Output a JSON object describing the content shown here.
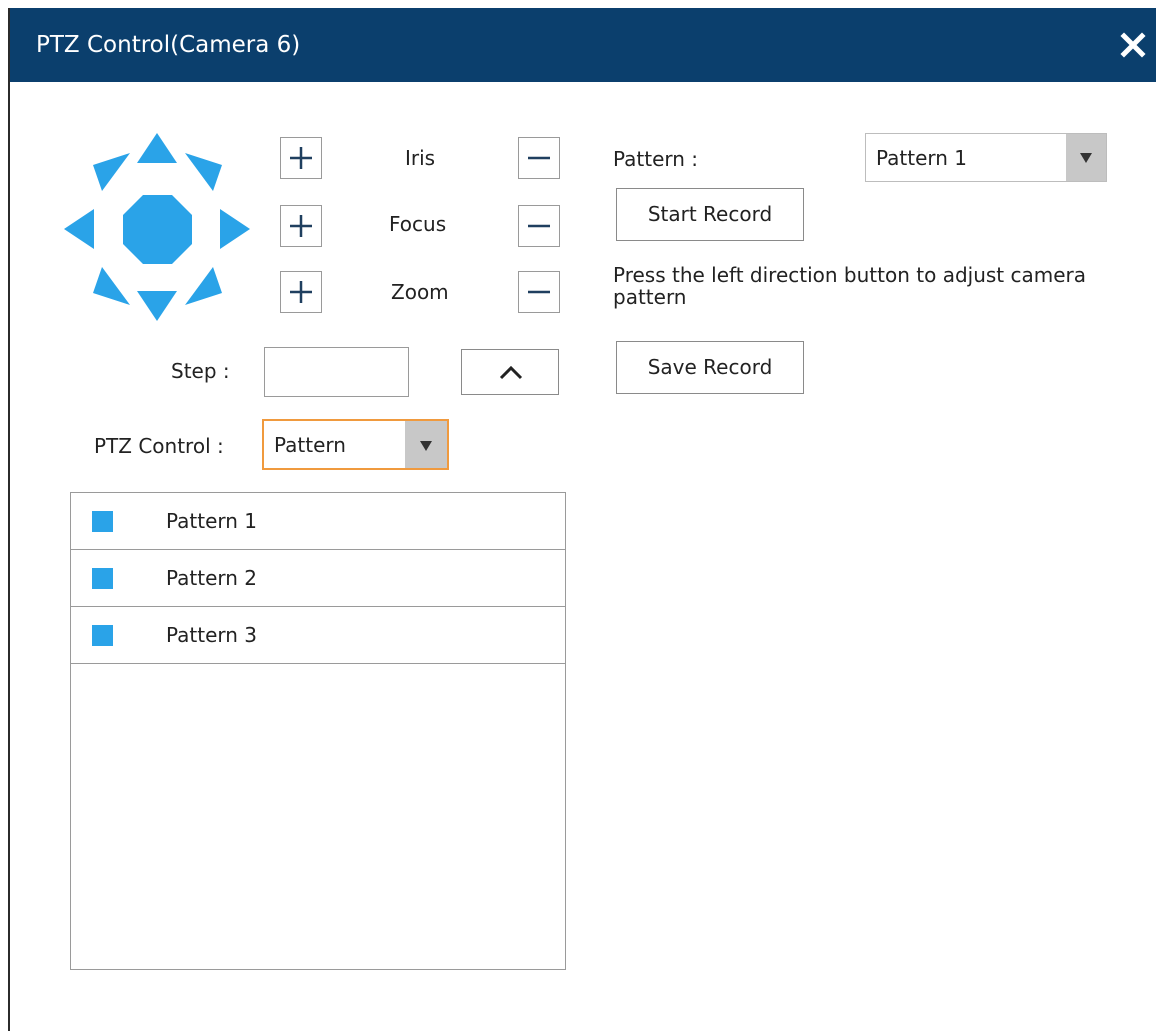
{
  "dialog": {
    "title": "PTZ Control(Camera 6)",
    "close_icon": "close-icon"
  },
  "colors": {
    "titlebar": "#0b3f6d",
    "accent": "#2aa3e8",
    "focus_border": "#f09a3e"
  },
  "lens": {
    "iris_label": "Iris",
    "focus_label": "Focus",
    "zoom_label": "Zoom",
    "plus_icon": "plus-icon",
    "minus_icon": "minus-icon"
  },
  "step": {
    "label": "Step :",
    "value": "",
    "up_icon": "chevron-up-icon"
  },
  "ptz_control": {
    "label": "PTZ Control :",
    "selected": "Pattern"
  },
  "patterns": [
    {
      "label": "Pattern 1"
    },
    {
      "label": "Pattern 2"
    },
    {
      "label": "Pattern 3"
    }
  ],
  "pattern_panel": {
    "label": "Pattern :",
    "selected": "Pattern 1",
    "start_record": "Start Record",
    "hint": "Press the left direction button to adjust camera pattern",
    "save_record": "Save Record"
  }
}
